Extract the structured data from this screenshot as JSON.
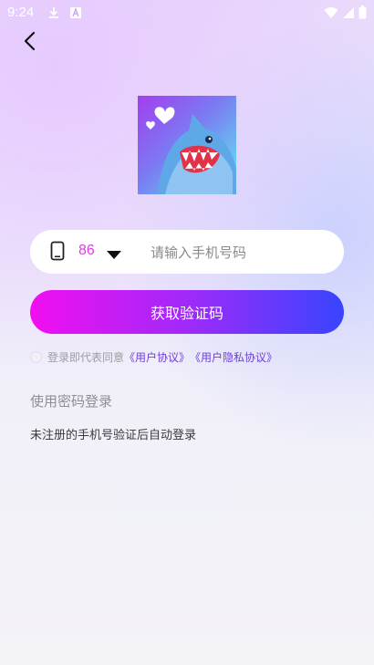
{
  "status_bar": {
    "time": "9:24"
  },
  "icons": {
    "back": "chevron-left-icon",
    "phone": "phone-icon",
    "dropdown": "caret-down-icon",
    "logo": "shark-logo"
  },
  "login": {
    "country_code": "86",
    "phone_placeholder": "请输入手机号码",
    "get_code_label": "获取验证码",
    "agreement_prefix": "登录即代表同意",
    "user_agreement": "《用户协议》",
    "privacy_agreement": "《用户隐私协议》",
    "password_login_label": "使用密码登录",
    "auto_register_note": "未注册的手机号验证后自动登录"
  },
  "colors": {
    "accent_magenta": "#f10ef0",
    "accent_blue": "#3845ff",
    "country_code": "#e23bdf",
    "link": "#6e3fd8"
  }
}
